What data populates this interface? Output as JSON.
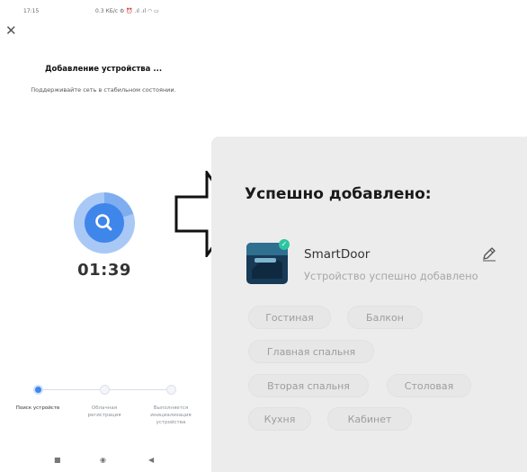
{
  "status_bar": {
    "time": "17:15",
    "right": "0.3 КБ/с ⚙ ⏰ .ıl .ıl ◠ ▭"
  },
  "left_screen": {
    "title": "Добавление устройства ...",
    "subtitle": "Поддерживайте сеть в стабильном состоянии.",
    "timer": "01:39",
    "steps": [
      {
        "label": "Поиск устройств",
        "active": true
      },
      {
        "label": "Облачная регистрация",
        "active": false
      },
      {
        "label": "Выполняется инициализация устройства",
        "active": false
      }
    ],
    "nav_icons": [
      "square-nav-icon",
      "circle-nav-icon",
      "back-nav-icon"
    ]
  },
  "right_screen": {
    "title": "Успешно добавлено:",
    "device": {
      "name": "SmartDoor",
      "status": "Устройство успешно добавлено"
    },
    "rooms": [
      "Гостиная",
      "Балкон",
      "Главная спальня",
      "Вторая спальня",
      "Столовая",
      "Кухня",
      "Кабинет"
    ]
  },
  "colors": {
    "accent": "#3f86ea",
    "spinner_ring": "#a9c8f6",
    "card_bg": "#ececec",
    "badge": "#2ec4a0"
  }
}
